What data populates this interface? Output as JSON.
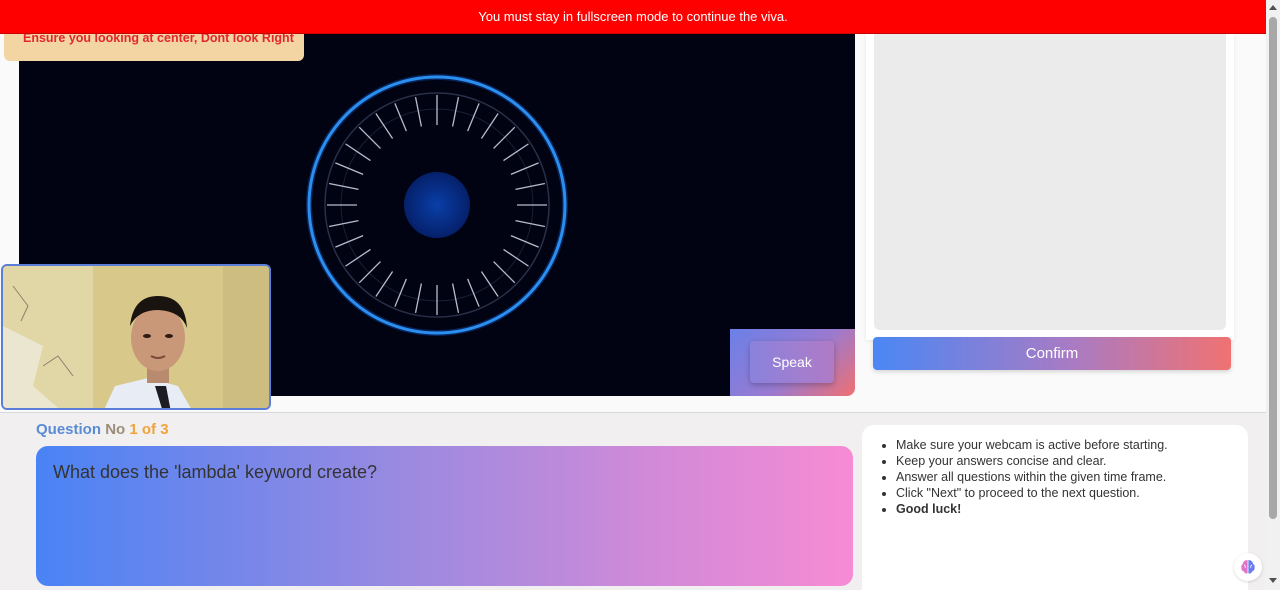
{
  "banner": {
    "text": "You must stay in fullscreen mode to continue the viva."
  },
  "warning": {
    "text": "Ensure you looking at center, Dont look Right"
  },
  "controls": {
    "speak_label": "Speak",
    "confirm_label": "Confirm"
  },
  "question": {
    "label_word1": "Question",
    "label_word2": "No",
    "counter": "1 of 3",
    "text": "What does the 'lambda' keyword create?"
  },
  "instructions": [
    "Make sure your webcam is active before starting.",
    "Keep your answers concise and clear.",
    "Answer all questions within the given time frame.",
    "Click \"Next\" to proceed to the next question.",
    "Good luck!"
  ],
  "icons": {
    "assistant": "brain-icon"
  },
  "colors": {
    "banner": "#ff0000",
    "accent_blue": "#4a87f4",
    "accent_pink": "#f07272",
    "stage_bg": "#010312"
  }
}
